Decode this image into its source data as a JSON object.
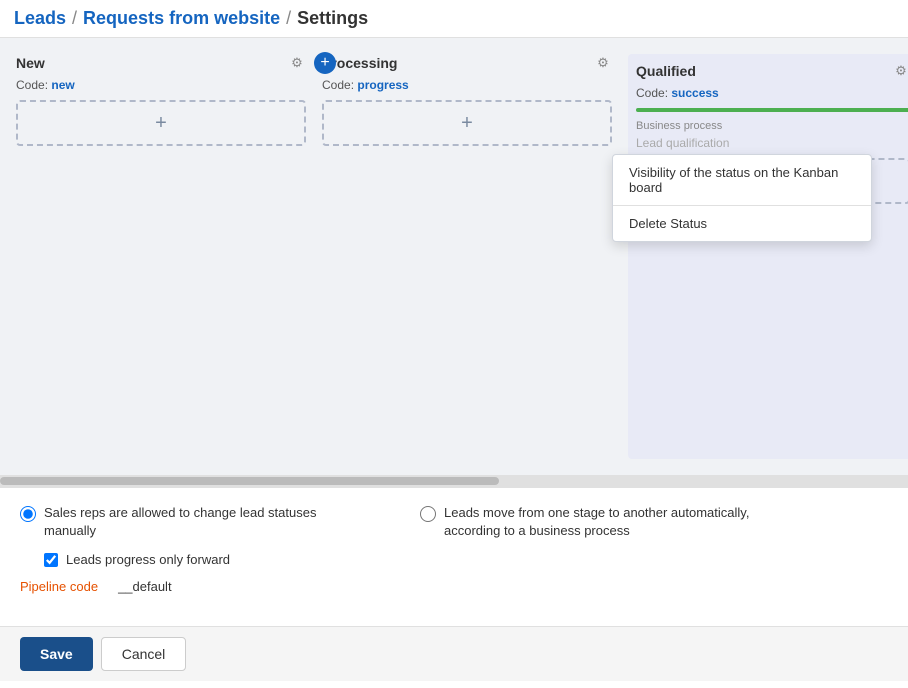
{
  "breadcrumb": {
    "crumb1": "Leads",
    "separator1": "/",
    "crumb2": "Requests from website",
    "separator2": "/",
    "crumb3": "Settings"
  },
  "columns": [
    {
      "id": "new",
      "title": "New",
      "code_label": "Code:",
      "code_value": "new",
      "has_plus": false
    },
    {
      "id": "processing",
      "title": "Processing",
      "code_label": "Code:",
      "code_value": "progress",
      "has_plus": true
    },
    {
      "id": "qualified",
      "title": "Qualified",
      "code_label": "Code:",
      "code_value": "success",
      "bp_label": "Business process",
      "bp_value": "Lead qualification",
      "has_plus": false
    }
  ],
  "dropdown": {
    "item1": "Visibility of the status on the Kanban board",
    "item2": "Delete Status"
  },
  "settings": {
    "radio1_label": "Sales reps are allowed to change lead statuses manually",
    "radio2_label": "Leads move from one stage to another automatically, according to a business process",
    "checkbox_label": "Leads progress only forward",
    "pipeline_code_label": "Pipeline code",
    "pipeline_code_value": "__default"
  },
  "footer": {
    "save_label": "Save",
    "cancel_label": "Cancel"
  },
  "icons": {
    "gear": "⚙",
    "plus": "+",
    "check": "✓"
  }
}
